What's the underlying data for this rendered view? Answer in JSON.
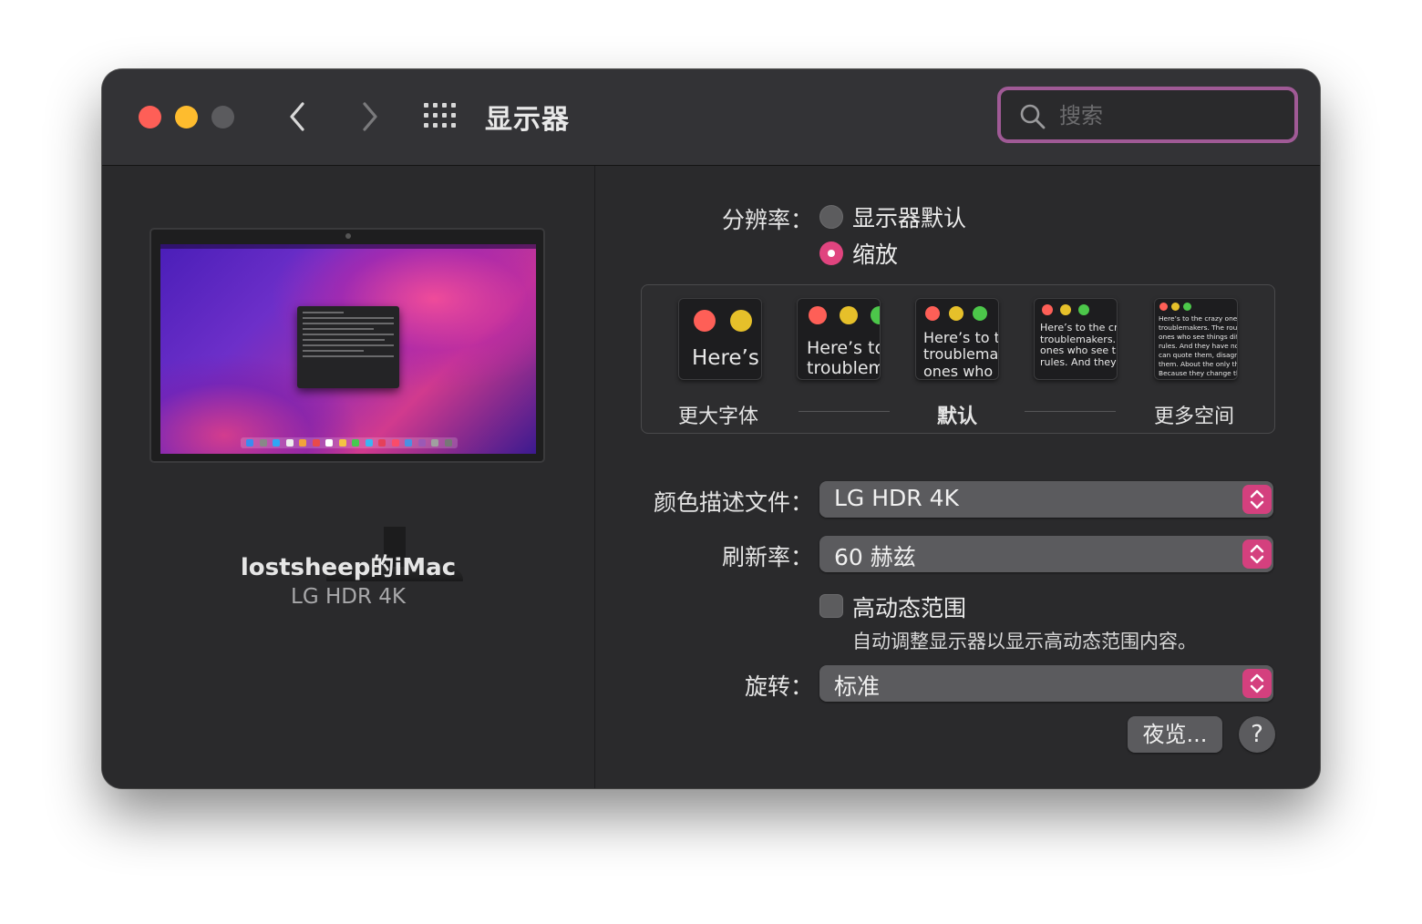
{
  "window": {
    "title": "显示器"
  },
  "search": {
    "placeholder": "搜索"
  },
  "device": {
    "name": "lostsheep的iMac",
    "model": "LG HDR 4K"
  },
  "resolution": {
    "label": "分辨率：",
    "options": [
      {
        "label": "显示器默认",
        "selected": false
      },
      {
        "label": "缩放",
        "selected": true
      }
    ]
  },
  "scaling": {
    "thumbs": [
      {
        "text": "Here’s"
      },
      {
        "text": "Here’s to\ntroublem"
      },
      {
        "text": "Here’s to t\ntroublema\nones who"
      },
      {
        "text": "Here’s to the cr\ntroublemakers.\nones who see t\nrules. And they"
      },
      {
        "text": "Here’s to the crazy one\ntroublemakers. The rou\nones who see things dif\nrules. And they have no\ncan quote them, disagr\nthem. About the only th\nBecause they change th"
      }
    ],
    "labels": {
      "larger": "更大字体",
      "default": "默认",
      "more_space": "更多空间"
    }
  },
  "color_profile": {
    "label": "颜色描述文件：",
    "value": "LG HDR 4K"
  },
  "refresh_rate": {
    "label": "刷新率：",
    "value": "60 赫兹"
  },
  "hdr": {
    "label": "高动态范围",
    "checked": false,
    "hint": "自动调整显示器以显示高动态范围内容。"
  },
  "rotation": {
    "label": "旋转：",
    "value": "标准"
  },
  "buttons": {
    "night_shift": "夜览...",
    "help": "?"
  },
  "colors": {
    "accent": "#e0447f",
    "focus_ring": "#a05a96"
  }
}
